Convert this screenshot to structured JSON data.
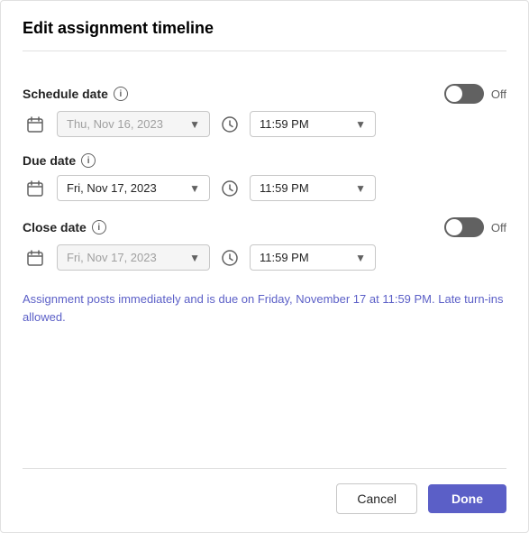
{
  "dialog": {
    "title": "Edit assignment timeline"
  },
  "schedule_date": {
    "label": "Schedule date",
    "toggle_label": "Off",
    "date_value": "Thu, Nov 16, 2023",
    "time_value": "11:59 PM",
    "enabled": false
  },
  "due_date": {
    "label": "Due date",
    "date_value": "Fri, Nov 17, 2023",
    "time_value": "11:59 PM",
    "enabled": true
  },
  "close_date": {
    "label": "Close date",
    "toggle_label": "Off",
    "date_value": "Fri, Nov 17, 2023",
    "time_value": "11:59 PM",
    "enabled": false
  },
  "info_text": "Assignment posts immediately and is due on Friday, November 17 at 11:59 PM. Late turn-ins allowed.",
  "buttons": {
    "cancel": "Cancel",
    "done": "Done"
  }
}
